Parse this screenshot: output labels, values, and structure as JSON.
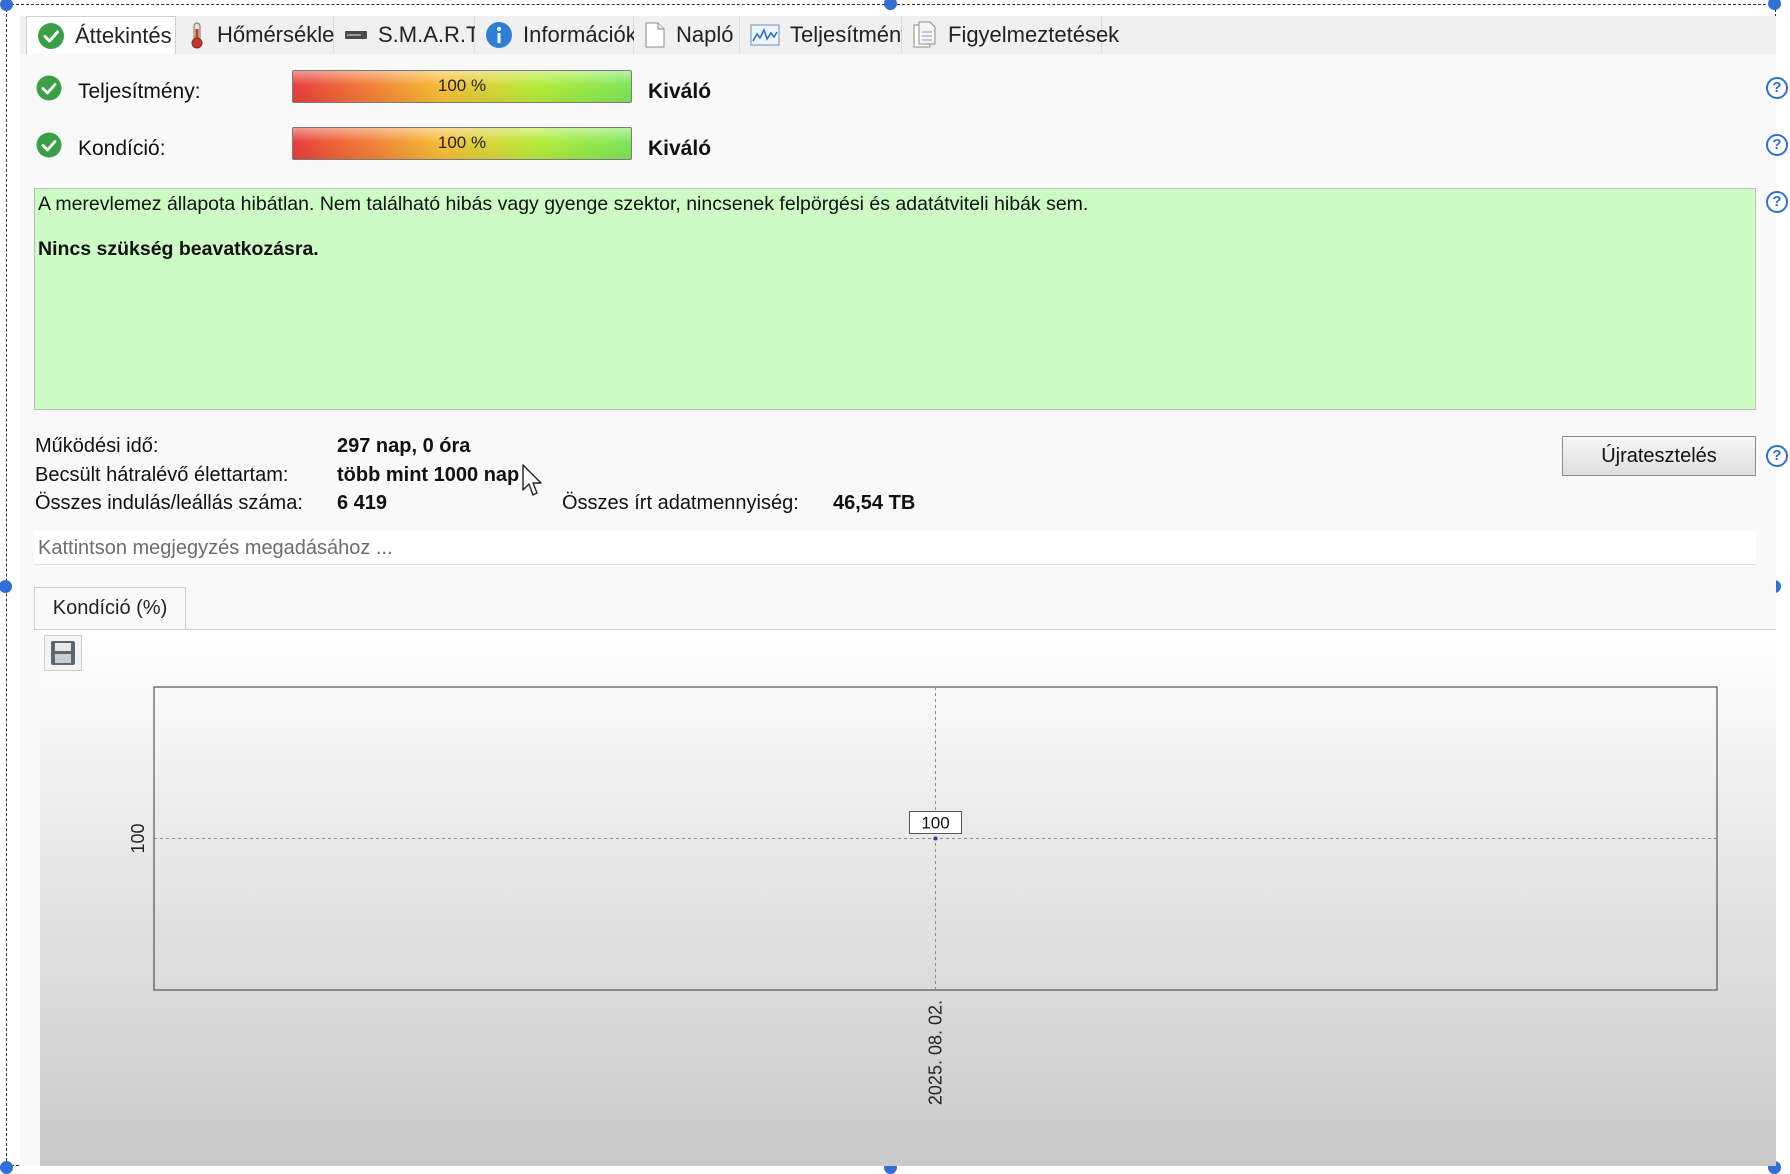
{
  "tabs": [
    {
      "label": "Áttekintés",
      "icon": "check-circle-icon",
      "active": true
    },
    {
      "label": "Hőmérséklet",
      "icon": "thermometer-icon"
    },
    {
      "label": "S.M.A.R.T.",
      "icon": "drive-icon"
    },
    {
      "label": "Információk",
      "icon": "info-icon"
    },
    {
      "label": "Napló",
      "icon": "document-icon"
    },
    {
      "label": "Teljesítmény",
      "icon": "performance-graph-icon"
    },
    {
      "label": "Figyelmeztetések",
      "icon": "alerts-document-icon"
    }
  ],
  "health": {
    "performance": {
      "label": "Teljesítmény:",
      "bar_text": "100 %",
      "value_percent": 100,
      "grade": "Kiváló"
    },
    "condition": {
      "label": "Kondíció:",
      "bar_text": "100 %",
      "value_percent": 100,
      "grade": "Kiváló"
    }
  },
  "status": {
    "message": "A merevlemez állapota hibátlan. Nem található hibás vagy gyenge szektor, nincsenek felpörgési és adatátviteli hibák sem.",
    "recommendation": "Nincs szükség beavatkozásra.",
    "background_color": "#ccfcc4"
  },
  "details": {
    "uptime_label": "Működési idő:",
    "uptime_value": "297 nap, 0 óra",
    "lifetime_label": "Becsült hátralévő élettartam:",
    "lifetime_value": "több mint 1000 nap",
    "startstop_label": "Összes indulás/leállás száma:",
    "startstop_value": "6 419",
    "written_label": "Összes írt adatmennyiség:",
    "written_value": "46,54 TB"
  },
  "retest_button": "Újratesztelés",
  "note_placeholder": "Kattintson megjegyzés megadásához ...",
  "chart_tab": "Kondíció  (%)",
  "help_glyph": "?",
  "colors": {
    "accent": "#2f6fd6",
    "check_green": "#3aa046"
  },
  "chart_data": {
    "type": "line",
    "title": "",
    "xlabel": "",
    "ylabel": "",
    "x": [
      "2025. 08. 02."
    ],
    "series": [
      {
        "values": [
          100
        ]
      }
    ],
    "y_ticks": [
      100
    ],
    "data_labels": [
      "100"
    ],
    "grid": true
  }
}
